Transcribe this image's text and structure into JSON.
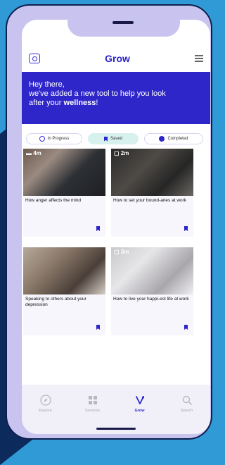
{
  "header": {
    "title": "Grow"
  },
  "banner": {
    "line1": "Hey there,",
    "line2": "we've added a new tool to help you look",
    "line3_prefix": "after your ",
    "line3_bold": "wellness",
    "line3_suffix": "!"
  },
  "tabs": [
    {
      "label": "In Progress",
      "icon": "progress-icon"
    },
    {
      "label": "Saved",
      "icon": "bookmark-icon"
    },
    {
      "label": "Completed",
      "icon": "check-circle-icon"
    }
  ],
  "cards": [
    {
      "duration": "4m",
      "title": "How anger affects the mind",
      "bookmarked": true
    },
    {
      "duration": "2m",
      "title": "How to set your bound-aries at work",
      "bookmarked": true
    },
    {
      "duration": "",
      "title": "Speaking to others about your depression",
      "bookmarked": true
    },
    {
      "duration": "3m",
      "title": "How to live your happi-est life at work",
      "bookmarked": true
    }
  ],
  "nav": [
    {
      "label": "Explore",
      "icon": "compass-icon"
    },
    {
      "label": "Services",
      "icon": "grid-icon"
    },
    {
      "label": "Grow",
      "icon": "grow-icon",
      "active": true
    },
    {
      "label": "Search",
      "icon": "search-icon"
    }
  ],
  "colors": {
    "primary": "#2e26c9",
    "background_blue": "#2f9ad6",
    "background_navy": "#0d2a5c",
    "phone_frame": "#c9c4ef",
    "saved_tab": "#d7f1ef"
  }
}
